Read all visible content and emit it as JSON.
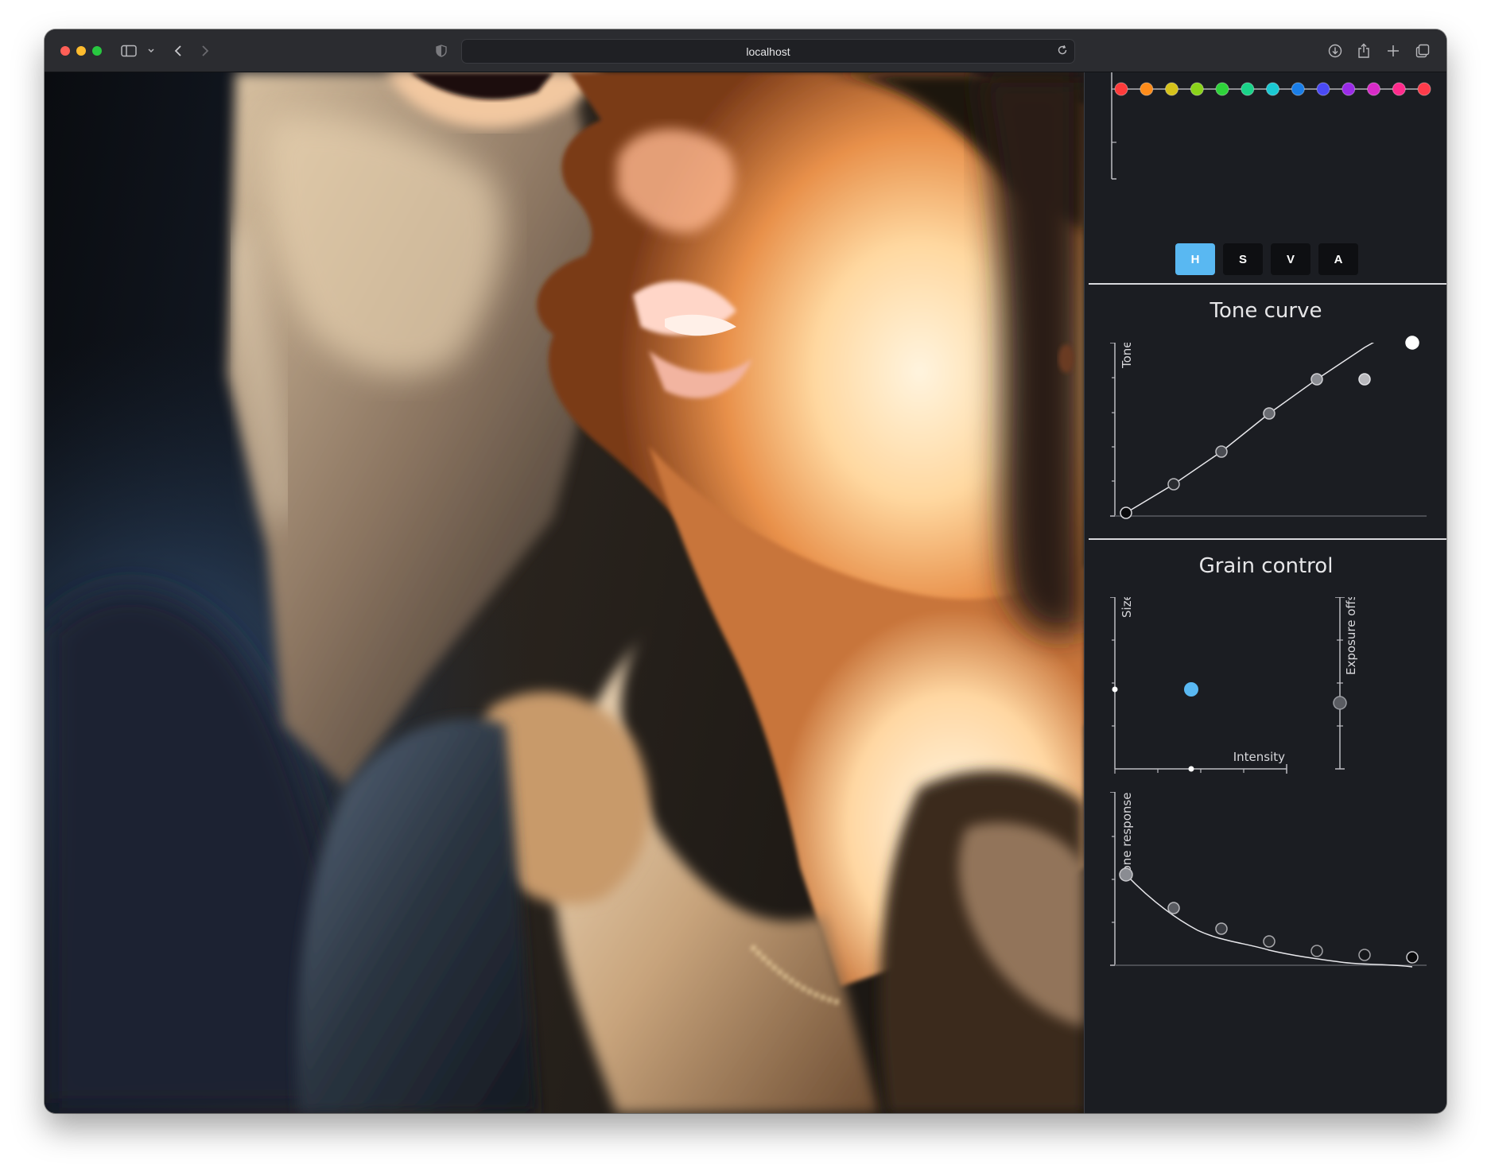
{
  "browser": {
    "url": "localhost",
    "icons": [
      "sidebar-icon",
      "chevron-down-icon",
      "back-icon",
      "forward-icon",
      "shield-icon",
      "reload-icon",
      "download-icon",
      "share-icon",
      "plus-icon",
      "tabs-icon"
    ]
  },
  "hue_strip": {
    "colors": [
      "#ff3b3b",
      "#ff8c1a",
      "#d6c21a",
      "#8ad31a",
      "#2ed33a",
      "#1ad389",
      "#1ac9d3",
      "#1a7ee8",
      "#4a4af5",
      "#9a2be8",
      "#d82bc8",
      "#ff2b8c",
      "#ff3b4a"
    ]
  },
  "channel_tabs": [
    {
      "label": "H",
      "active": true
    },
    {
      "label": "S",
      "active": false
    },
    {
      "label": "V",
      "active": false
    },
    {
      "label": "A",
      "active": false
    }
  ],
  "tone_curve": {
    "title": "Tone curve",
    "ylabel": "Tone"
  },
  "grain_control": {
    "title": "Grain control",
    "size_label": "Size",
    "intensity_label": "Intensity",
    "exposure_label": "Exposure offset"
  },
  "tone_response": {
    "ylabel": "Tone response"
  },
  "colors": {
    "accent": "#59b8f2",
    "panel_bg": "#1b1d22"
  }
}
